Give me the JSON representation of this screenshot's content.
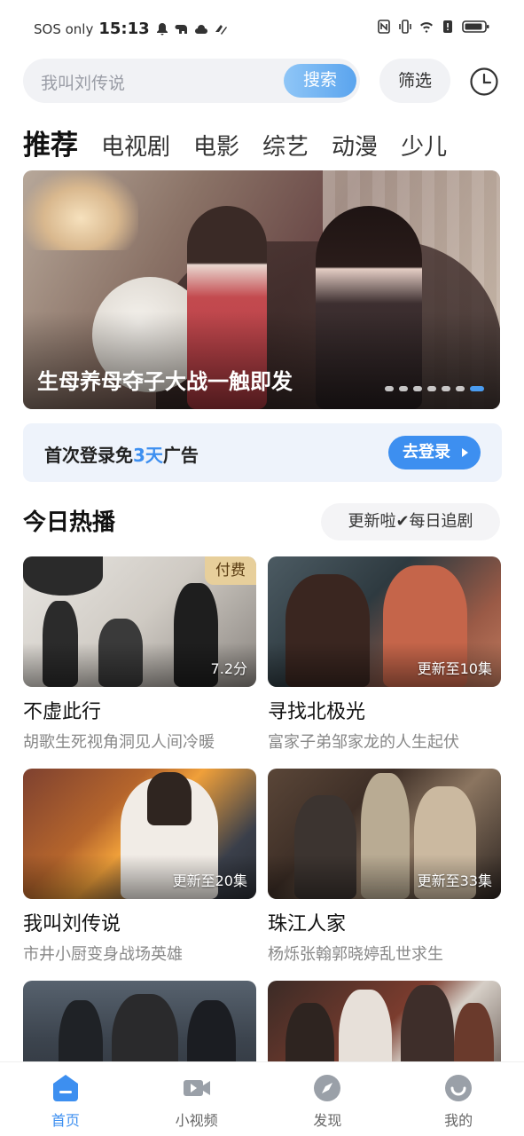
{
  "status_bar": {
    "carrier": "SOS only",
    "time": "15:13"
  },
  "search": {
    "placeholder": "我叫刘传说",
    "button_label": "搜索",
    "filter_label": "筛选"
  },
  "tabs": [
    {
      "label": "推荐",
      "active": true
    },
    {
      "label": "电视剧",
      "active": false
    },
    {
      "label": "电影",
      "active": false
    },
    {
      "label": "综艺",
      "active": false
    },
    {
      "label": "动漫",
      "active": false
    },
    {
      "label": "少儿",
      "active": false
    }
  ],
  "banner": {
    "caption": "生母养母夺子大战一触即发",
    "dot_count": 7,
    "active_dot": 6
  },
  "login_promo": {
    "text_before": "首次登录免",
    "highlight": "3天",
    "text_after": "广告",
    "button_label": "去登录"
  },
  "section": {
    "title": "今日热播",
    "tag": "更新啦✔每日追剧"
  },
  "cards": [
    {
      "title": "不虚此行",
      "subtitle": "胡歌生死视角洞见人间冷暖",
      "badge": "付费",
      "corner": "7.2分"
    },
    {
      "title": "寻找北极光",
      "subtitle": "富家子弟邹家龙的人生起伏",
      "badge": "",
      "corner": "更新至10集"
    },
    {
      "title": "我叫刘传说",
      "subtitle": "市井小厨变身战场英雄",
      "badge": "",
      "corner": "更新至20集"
    },
    {
      "title": "珠江人家",
      "subtitle": "杨烁张翰郭晓婷乱世求生",
      "badge": "",
      "corner": "更新至33集"
    },
    {
      "title": "",
      "subtitle": "",
      "badge": "",
      "corner": ""
    },
    {
      "title": "",
      "subtitle": "",
      "badge": "",
      "corner": ""
    }
  ],
  "bottom_nav": [
    {
      "label": "首页",
      "icon": "home-icon",
      "active": true
    },
    {
      "label": "小视频",
      "icon": "video-camera-icon",
      "active": false
    },
    {
      "label": "发现",
      "icon": "compass-icon",
      "active": false
    },
    {
      "label": "我的",
      "icon": "profile-icon",
      "active": false
    }
  ],
  "colors": {
    "accent": "#3d8ff0",
    "paid_badge": "#e7cf9b"
  }
}
